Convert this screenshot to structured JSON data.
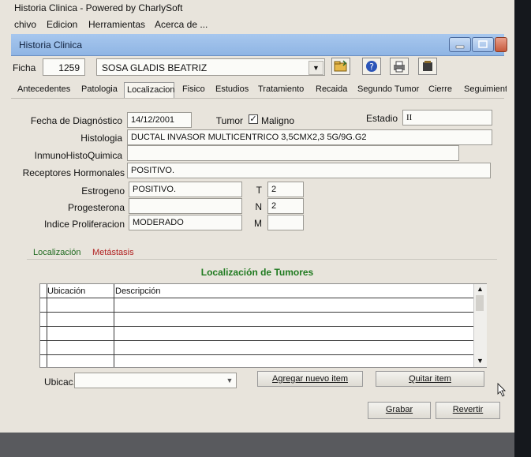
{
  "app_title": "Historia Clinica - Powered by CharlySoft",
  "menu": [
    "chivo",
    "Edicion",
    "Herramientas",
    "Acerca de ..."
  ],
  "inner_window_title": "Historia Clinica",
  "patient": {
    "ficha_label": "Ficha",
    "ficha_number": "1259",
    "name": "SOSA GLADIS BEATRIZ"
  },
  "tabs": [
    "Antecedentes",
    "Patologia",
    "Localizacion",
    "Fisico",
    "Estudios",
    "Tratamiento",
    "Recaida",
    "Segundo Tumor",
    "Cierre",
    "Seguimiento"
  ],
  "form": {
    "fecha_label": "Fecha de Diagnóstico",
    "fecha_value": "14/12/2001",
    "tumor_label": "Tumor",
    "maligno_label": "Maligno",
    "maligno_checked": "✓",
    "estadio_label": "Estadio",
    "estadio_value": "II",
    "histologia_label": "Histologia",
    "histologia_value": "DUCTAL INVASOR MULTICENTRICO 3,5CMX2,3 5G/9G.G2",
    "inmuno_label": "InmunoHistoQuimica",
    "inmuno_value": "",
    "receptores_label": "Receptores Hormonales",
    "receptores_value": "POSITIVO.",
    "estrogeno_label": "Estrogeno",
    "estrogeno_value": "POSITIVO.",
    "progesterona_label": "Progesterona",
    "progesterona_value": "",
    "indice_label": "Indice Proliferacion",
    "indice_value": "MODERADO",
    "t_label": "T",
    "t_value": "2",
    "n_label": "N",
    "n_value": "2",
    "m_label": "M",
    "m_value": ""
  },
  "subtabs": [
    "Localización",
    "Metástasis"
  ],
  "section_title": "Localización de Tumores",
  "table": {
    "columns": [
      "Ubicación",
      "Descripción"
    ],
    "rows": []
  },
  "ubicac_label": "Ubicac.",
  "buttons": {
    "agregar": "Agregar nuevo item",
    "quitar": "Quitar item",
    "grabar": "Grabar",
    "revertir": "Revertir"
  },
  "colors": {
    "section_title": "#1f7a1f",
    "active_subtab": "#1f6a1f",
    "inactive_subtab": "#b02020",
    "inner_titlebar": "#9cbde8"
  }
}
